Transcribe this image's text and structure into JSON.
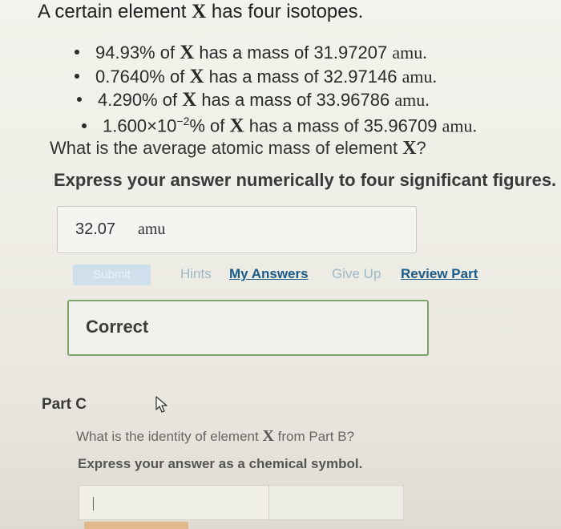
{
  "problem": {
    "intro": {
      "before": "A certain element ",
      "symbol": "X",
      "after": " has four isotopes."
    },
    "isotopes": [
      {
        "percent": "94.93%",
        "of": " of ",
        "symbol": "X",
        "text": " has a mass of 31.97207 ",
        "unit": "amu."
      },
      {
        "percent": "0.7640%",
        "of": " of ",
        "symbol": "X",
        "text": " has a mass of 32.97146 ",
        "unit": "amu."
      },
      {
        "percent": "4.290%",
        "of": " of ",
        "symbol": "X",
        "text": " has a mass of 33.96786 ",
        "unit": "amu."
      },
      {
        "mantissa": "1.600",
        "times": "×",
        "base": "10",
        "exponent": "−2",
        "pct": "%",
        "of": " of ",
        "symbol": "X",
        "text": " has a mass of 35.96709 ",
        "unit": "amu."
      }
    ],
    "question": {
      "before": "What is the average atomic mass of element ",
      "symbol": "X",
      "after": "?"
    },
    "instruction": "Express your answer numerically to four significant figures."
  },
  "answer": {
    "value": "32.07",
    "unit": "amu"
  },
  "actions": {
    "submit": "Submit",
    "hints": "Hints",
    "my_answers": "My Answers",
    "give_up": "Give Up",
    "review_part": "Review Part"
  },
  "feedback": {
    "label": "Correct"
  },
  "part_c": {
    "label": "Part C",
    "question": {
      "before": "What is the identity of element ",
      "symbol": "X",
      "after": " from Part B?"
    },
    "instruction": "Express your answer as a chemical symbol.",
    "input_value": ""
  },
  "colors": {
    "link": "#1a5b89",
    "correct_border": "#7da26a",
    "submit_disabled": "#cfe0ec"
  }
}
